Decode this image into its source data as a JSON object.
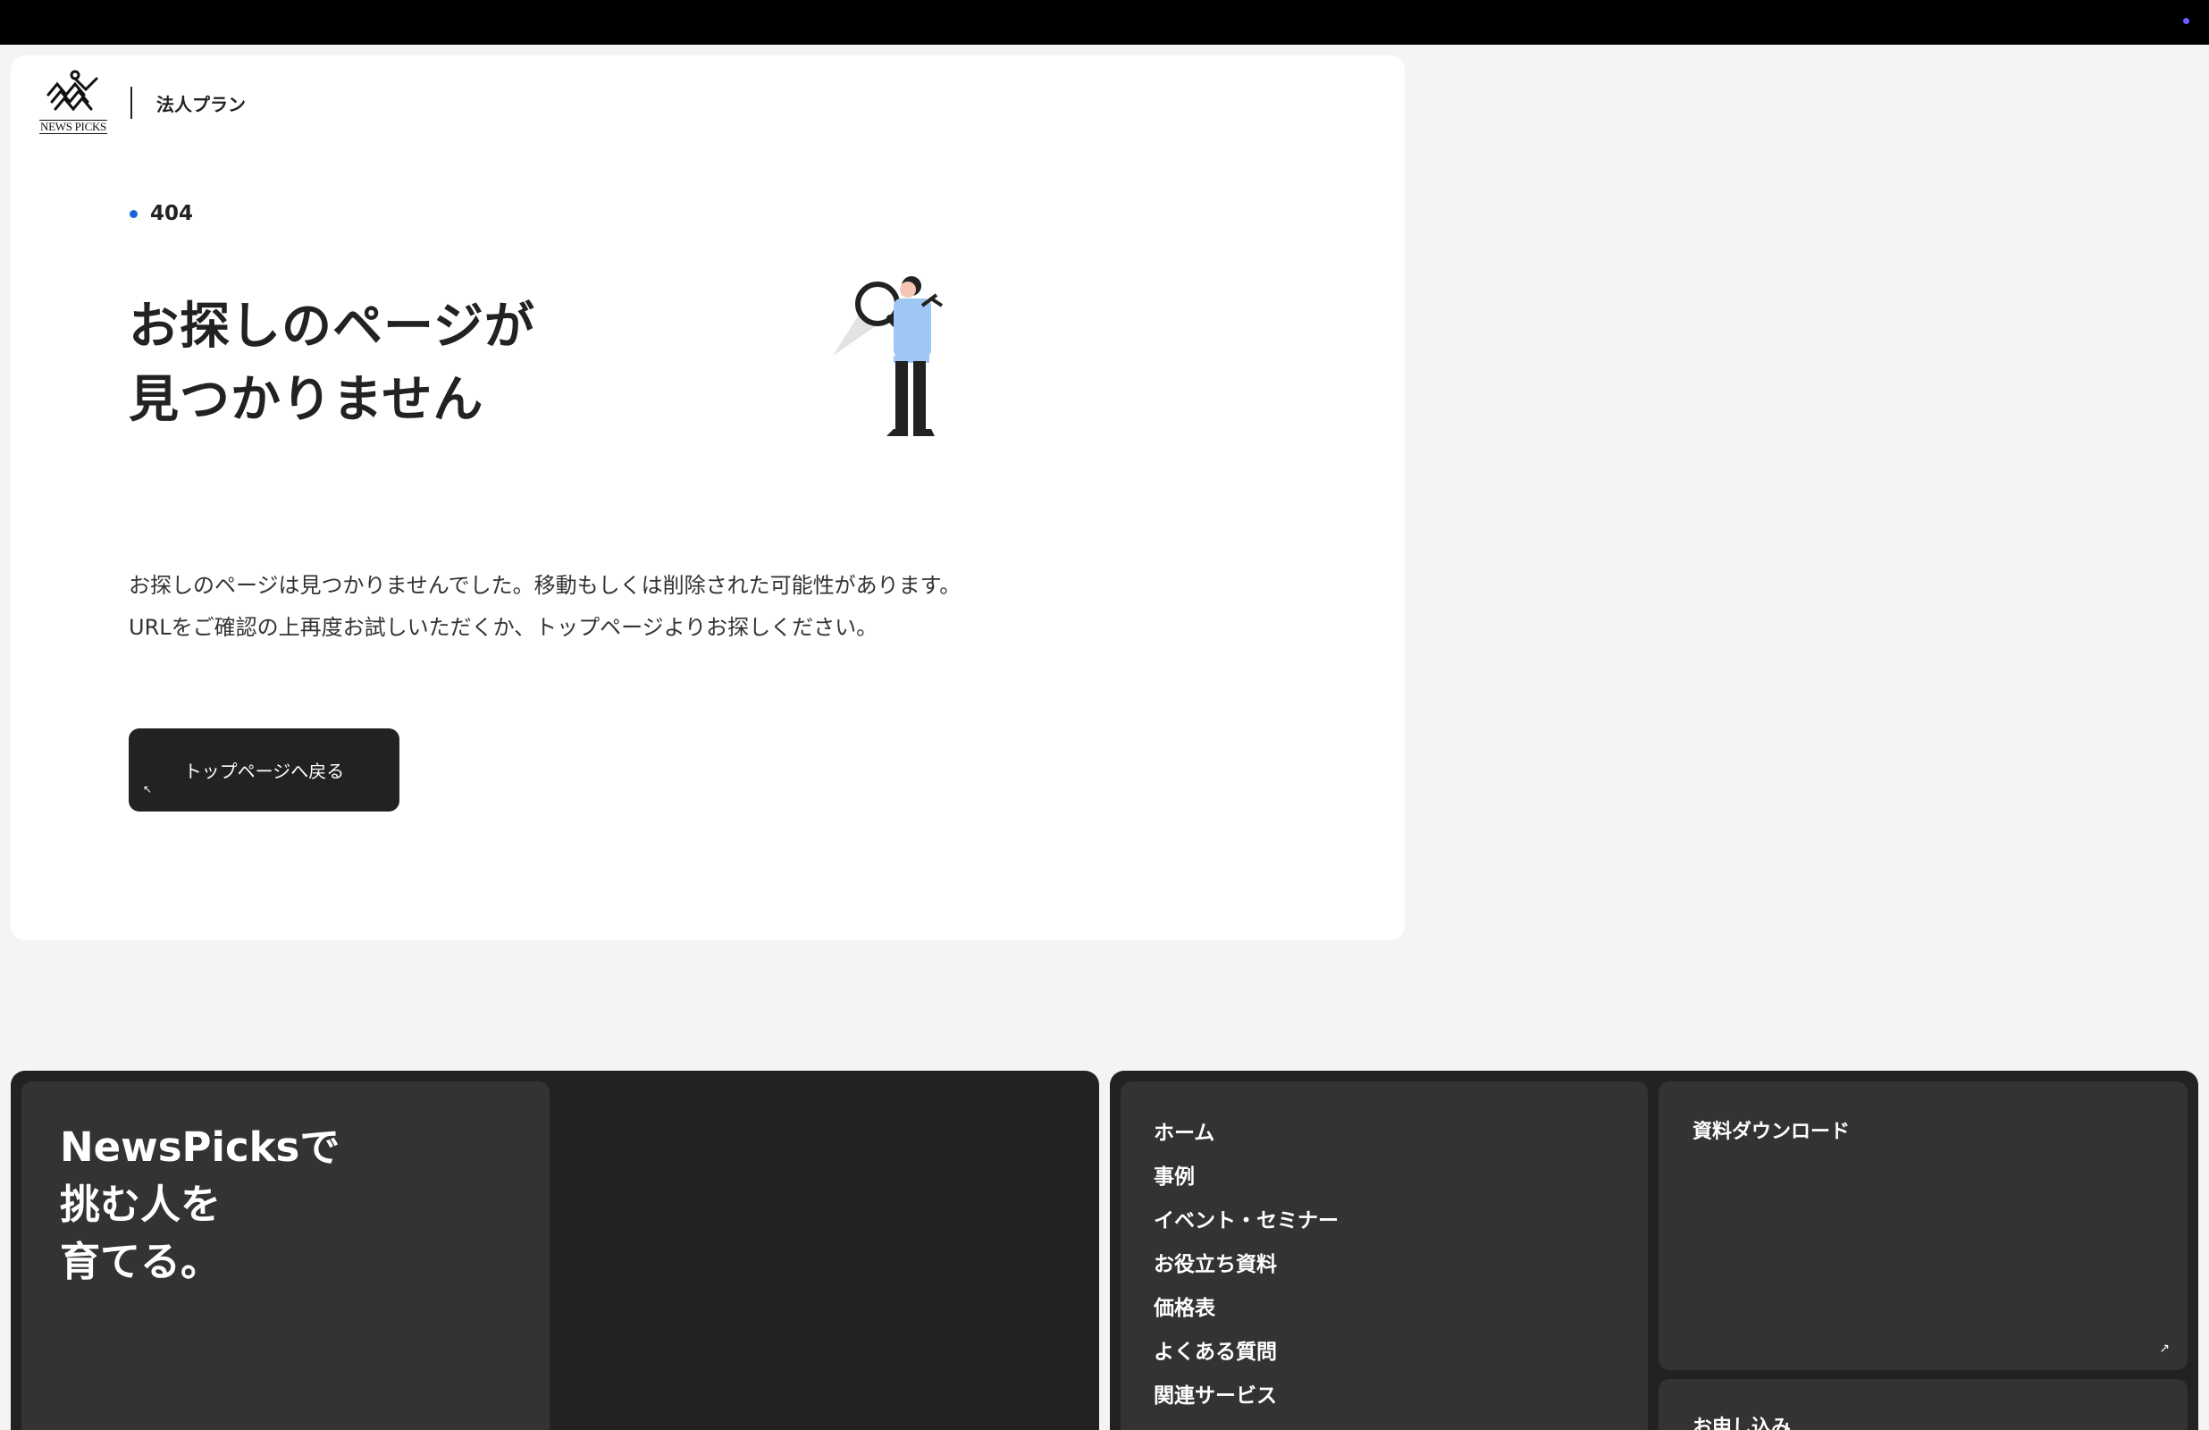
{
  "header": {
    "logo_text": "NEWS PICKS",
    "plan_label": "法人プラン"
  },
  "error": {
    "code": "404",
    "heading_line1": "お探しのページが",
    "heading_line2": "見つかりません",
    "description": "お探しのページは見つかりませんでした。移動もしくは削除された可能性があります。URLをご確認の上再度お試しいただくか、トップページよりお探しください。",
    "button_label": "トップページへ戻る"
  },
  "footer": {
    "tagline_line1": "NewsPicksで",
    "tagline_line2": "挑む人を",
    "tagline_line3": "育てる。",
    "nav": [
      {
        "label": "ホーム"
      },
      {
        "label": "事例"
      },
      {
        "label": "イベント・セミナー"
      },
      {
        "label": "お役立ち資料"
      },
      {
        "label": "価格表"
      },
      {
        "label": "よくある質問"
      },
      {
        "label": "関連サービス"
      }
    ],
    "download_label": "資料ダウンロード",
    "apply_label": "お申し込み"
  },
  "colors": {
    "accent_dot": "#1c63d5",
    "dark": "#222222",
    "panel": "#333333",
    "background": "#f4f4f4"
  }
}
